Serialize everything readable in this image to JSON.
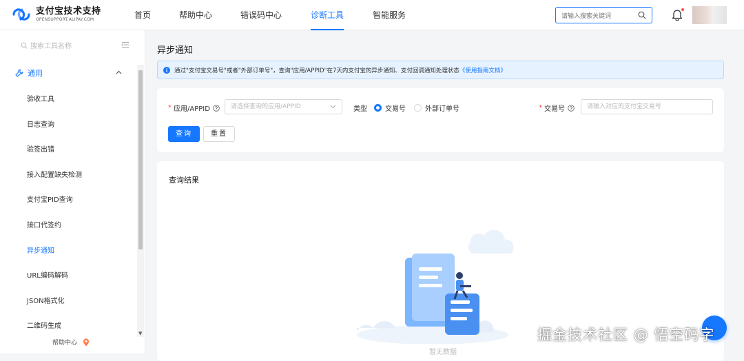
{
  "header": {
    "logo_title": "支付宝技术支持",
    "logo_subtitle": "OPENSUPPORT.ALIPAY.COM",
    "nav": [
      {
        "label": "首页",
        "active": false
      },
      {
        "label": "帮助中心",
        "active": false
      },
      {
        "label": "错误码中心",
        "active": false
      },
      {
        "label": "诊断工具",
        "active": true
      },
      {
        "label": "智能服务",
        "active": false
      }
    ],
    "search_placeholder": "请输入搜索关键词"
  },
  "sidebar": {
    "search_placeholder": "搜索工具名称",
    "group_label": "通用",
    "items": [
      {
        "label": "验收工具",
        "active": false
      },
      {
        "label": "日志查询",
        "active": false
      },
      {
        "label": "验签出错",
        "active": false
      },
      {
        "label": "接入配置缺失检测",
        "active": false
      },
      {
        "label": "支付宝PID查询",
        "active": false
      },
      {
        "label": "接口代签约",
        "active": false
      },
      {
        "label": "异步通知",
        "active": true
      },
      {
        "label": "URL编码解码",
        "active": false
      },
      {
        "label": "JSON格式化",
        "active": false
      },
      {
        "label": "二维码生成",
        "active": false
      }
    ],
    "help_label": "帮助中心"
  },
  "main": {
    "page_title": "异步通知",
    "notice_text": "通过\"支付宝交易号\"或者\"外部订单号\"，查询\"应用/APPID\"在7天内支付宝的异步通知、支付回调通知处理状态",
    "notice_link": "《使用指南文档》",
    "form": {
      "app_label": "应用/APPID",
      "app_placeholder": "请选择查询的应用/APPID",
      "type_label": "类型",
      "type_options": [
        {
          "label": "交易号",
          "checked": true
        },
        {
          "label": "外部订单号",
          "checked": false
        }
      ],
      "trade_label": "交易号",
      "trade_placeholder": "请输入对应的支付宝交易号",
      "query_button": "查询",
      "reset_button": "重置"
    },
    "result": {
      "title": "查询结果",
      "empty_text": "暂无数据"
    }
  },
  "watermark": "掘金技术社区 @ 悟空码字",
  "colors": {
    "accent": "#1677ff",
    "required": "#ff4d4f",
    "notice_bg": "#e6f2ff"
  }
}
